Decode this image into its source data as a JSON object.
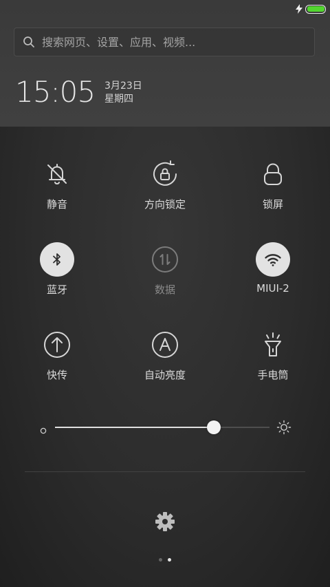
{
  "status_bar": {
    "battery_level": 1.0,
    "charging": true,
    "battery_color": "#52d62f"
  },
  "search": {
    "placeholder": "搜索网页、设置、应用、视频..."
  },
  "clock": {
    "time": "15:05",
    "date": "3月23日",
    "weekday": "星期四"
  },
  "tiles": [
    {
      "id": "mute",
      "label": "静音",
      "icon": "bell-off-icon",
      "state": "off"
    },
    {
      "id": "rotation-lock",
      "label": "方向锁定",
      "icon": "rotation-lock-icon",
      "state": "off"
    },
    {
      "id": "lock-screen",
      "label": "锁屏",
      "icon": "lock-icon",
      "state": "off"
    },
    {
      "id": "bluetooth",
      "label": "蓝牙",
      "icon": "bluetooth-icon",
      "state": "on"
    },
    {
      "id": "mobile-data",
      "label": "数据",
      "icon": "data-icon",
      "state": "disabled"
    },
    {
      "id": "wifi",
      "label": "MIUI-2",
      "icon": "wifi-icon",
      "state": "on"
    },
    {
      "id": "quick-share",
      "label": "快传",
      "icon": "upload-icon",
      "state": "off"
    },
    {
      "id": "auto-brightness",
      "label": "自动亮度",
      "icon": "auto-brightness-icon",
      "state": "off"
    },
    {
      "id": "flashlight",
      "label": "手电筒",
      "icon": "flashlight-icon",
      "state": "off"
    }
  ],
  "brightness": {
    "level": 0.74
  },
  "pager": {
    "pages": 2,
    "current": 2
  },
  "colors": {
    "tile_on_bg": "#e2e2e2",
    "text": "#dcdcdc",
    "disabled_text": "#8a8a8a"
  }
}
